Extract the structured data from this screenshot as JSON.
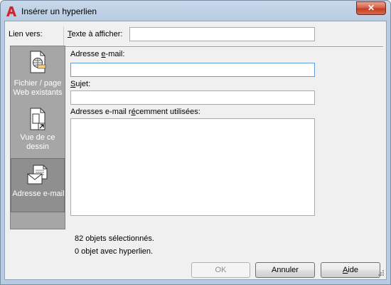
{
  "window": {
    "title": "Insérer un hyperlien",
    "close_symbol": "✕"
  },
  "link_to_label": "Lien vers:",
  "display_text": {
    "label_underlined": "T",
    "label_rest": "exte à afficher:",
    "value": ""
  },
  "sidebar": {
    "items": [
      {
        "label_line1": "Fichier / page",
        "label_line2": "Web existants",
        "icon": "web-file-icon",
        "selected": false
      },
      {
        "label_line1": "Vue de ce",
        "label_line2": "dessin",
        "icon": "drawing-view-icon",
        "selected": false
      },
      {
        "label_line1": "Adresse e-mail",
        "label_line2": "",
        "icon": "email-icon",
        "selected": true
      }
    ]
  },
  "email_address": {
    "label_pre": "Adresse ",
    "label_underlined": "e",
    "label_post": "-mail:",
    "value": ""
  },
  "subject": {
    "label_underlined": "S",
    "label_rest": "ujet:",
    "value": ""
  },
  "recent": {
    "label_pre": "Adresses e-mail r",
    "label_underlined": "é",
    "label_post": "cemment utilisées:",
    "items": []
  },
  "status": {
    "line1": "82 objets sélectionnés.",
    "line2": "0 objet avec hyperlien."
  },
  "buttons": {
    "ok": "OK",
    "cancel": "Annuler",
    "help_underlined": "A",
    "help_rest": "ide"
  },
  "colors": {
    "title_bar": "#b7cbe2",
    "close_button": "#c43d22",
    "sidebar": "#a6a6a6",
    "focus_border": "#5f9ed8"
  }
}
